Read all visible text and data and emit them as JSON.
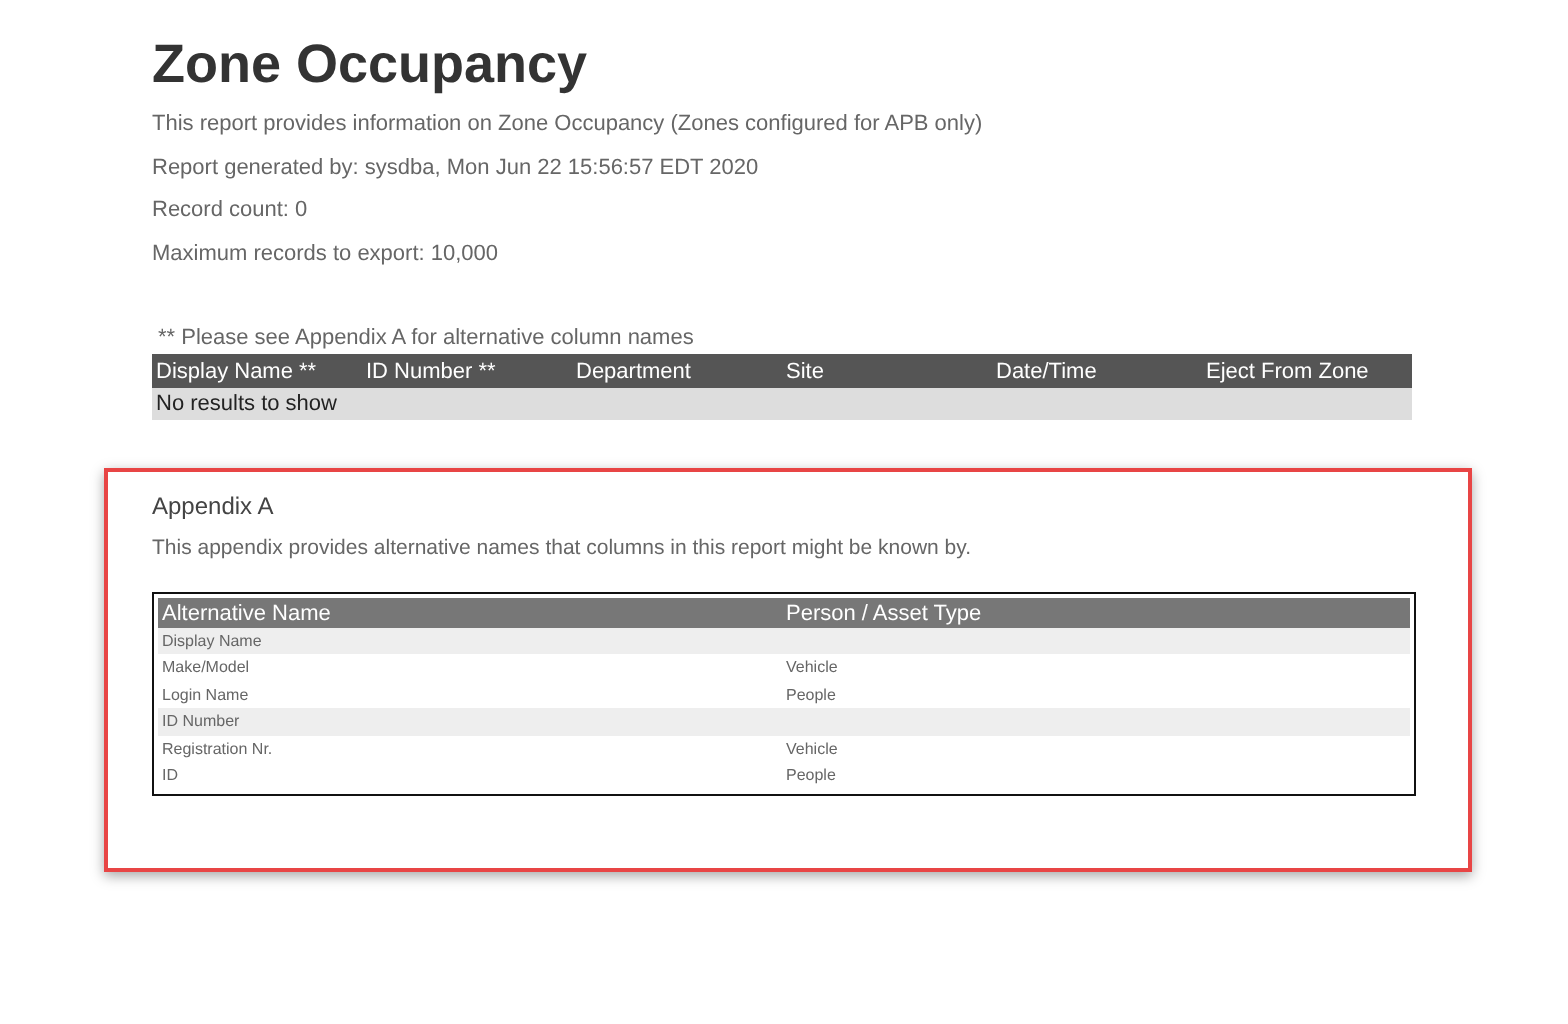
{
  "report": {
    "title": "Zone Occupancy",
    "lines": [
      "This report provides information on Zone Occupancy (Zones configured for APB only)",
      "Report generated by: sysdba, Mon Jun 22 15:56:57 EDT 2020",
      "Record count: 0",
      "Maximum records to export: 10,000"
    ]
  },
  "results": {
    "note": "** Please see Appendix A for alternative column names",
    "columns": [
      "Display Name **",
      "ID Number **",
      "Department",
      "Site",
      "Date/Time",
      "Eject From Zone"
    ],
    "empty_message": "No results to show"
  },
  "appendix": {
    "title": "Appendix A",
    "description": "This appendix provides alternative names that columns in this report might be known by.",
    "columns": [
      "Alternative Name",
      "Person / Asset Type"
    ],
    "rows": [
      {
        "kind": "group",
        "name": "Display Name",
        "type": ""
      },
      {
        "kind": "item",
        "name": "Make/Model",
        "type": "Vehicle"
      },
      {
        "kind": "item",
        "name": "Login Name",
        "type": "People"
      },
      {
        "kind": "group",
        "name": "ID Number",
        "type": ""
      },
      {
        "kind": "item",
        "name": "Registration Nr.",
        "type": "Vehicle"
      },
      {
        "kind": "item",
        "name": "ID",
        "type": "People"
      }
    ]
  }
}
